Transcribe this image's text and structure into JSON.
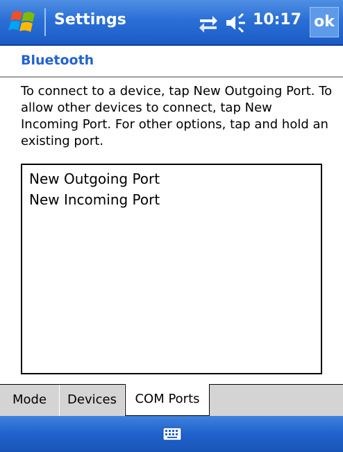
{
  "titlebar": {
    "title": "Settings",
    "clock": "10:17",
    "ok_label": "ok",
    "start_icon": "windows-flag-icon",
    "connectivity_icon": "connectivity-icon",
    "volume_icon": "speaker-icon"
  },
  "header": {
    "title": "Bluetooth"
  },
  "description": "To connect to a device, tap New Outgoing Port. To allow other devices to connect, tap New Incoming Port. For other options, tap and hold an existing port.",
  "port_list": {
    "items": [
      "New Outgoing Port",
      "New Incoming Port"
    ]
  },
  "tabs": [
    {
      "label": "Mode",
      "active": false
    },
    {
      "label": "Devices",
      "active": false
    },
    {
      "label": "COM Ports",
      "active": true
    }
  ],
  "command_bar": {
    "input_icon": "keyboard-icon"
  },
  "colors": {
    "titlebar_blue": "#2a6fd6",
    "header_text_blue": "#2163d0",
    "tab_bar_gray": "#d4d4d4"
  }
}
